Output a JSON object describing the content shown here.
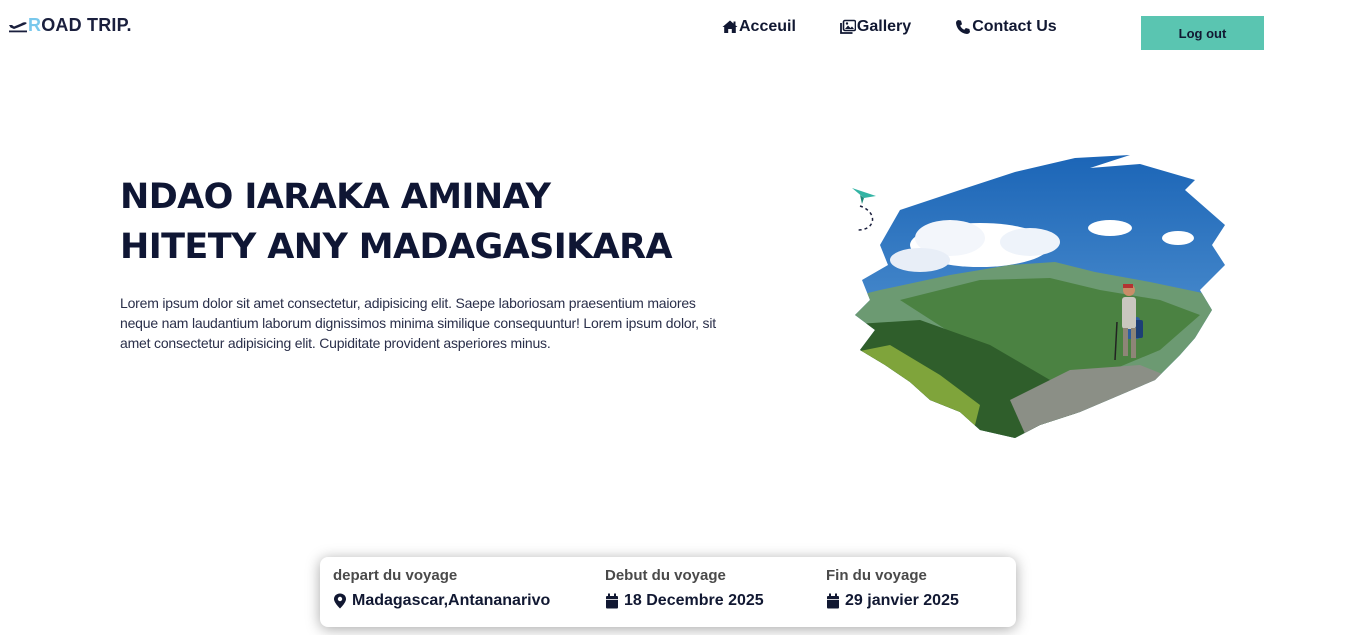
{
  "header": {
    "logo_first_letter": "R",
    "logo_rest": "OAD TRIP.",
    "nav": {
      "home": "Acceuil",
      "gallery": "Gallery",
      "contact": "Contact Us"
    },
    "logout_label": "Log out"
  },
  "hero": {
    "title_line1": "NDAO IARAKA AMINAY",
    "title_line2": "HITETY ANY MADAGASIKARA",
    "text": "Lorem ipsum dolor sit amet consectetur, adipisicing elit. Saepe laboriosam praesentium maiores neque nam laudantium laborum dignissimos minima similique consequuntur! Lorem ipsum dolor, sit amet consectetur adipisicing elit. Cupiditate provident asperiores minus."
  },
  "trip": {
    "depart_label": "depart du voyage",
    "depart_value": "Madagascar,Antananarivo",
    "start_label": "Debut du voyage",
    "start_value": "18 Decembre 2025",
    "end_label": "Fin du voyage",
    "end_value": "29 janvier 2025"
  },
  "colors": {
    "accent": "#5ac5b1",
    "logo_letter": "#79c8ec",
    "text_dark": "#0f1634"
  },
  "icons": {
    "logo": "plane-departure-icon",
    "home": "home-icon",
    "gallery": "images-icon",
    "contact": "phone-icon",
    "depart": "map-marker-icon",
    "start": "calendar-icon",
    "end": "calendar-icon"
  }
}
